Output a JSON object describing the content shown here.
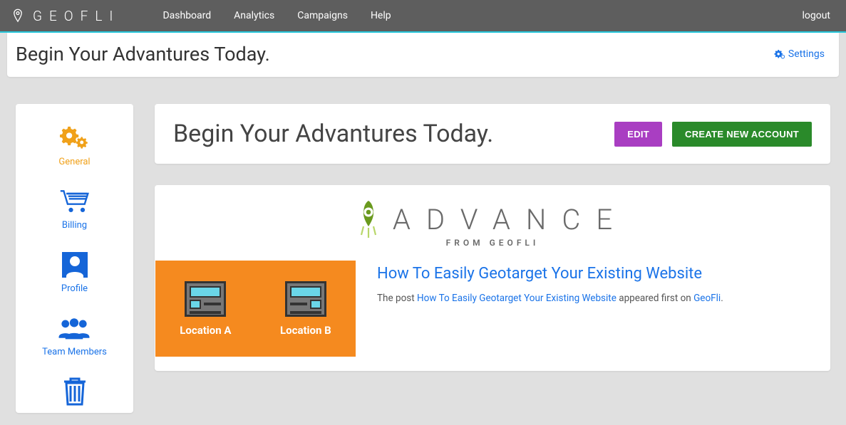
{
  "header": {
    "brand": "GEOFLI",
    "nav": {
      "dashboard": "Dashboard",
      "analytics": "Analytics",
      "campaigns": "Campaigns",
      "help": "Help"
    },
    "logout": "logout"
  },
  "titlebar": {
    "title": "Begin Your Advantures Today.",
    "settings_label": "Settings"
  },
  "sidebar": {
    "items": [
      {
        "label": "General",
        "active": true
      },
      {
        "label": "Billing",
        "active": false
      },
      {
        "label": "Profile",
        "active": false
      },
      {
        "label": "Team Members",
        "active": false
      }
    ]
  },
  "panel": {
    "title": "Begin Your Advantures Today.",
    "edit_label": "EDIT",
    "create_label": "CREATE NEW ACCOUNT"
  },
  "brand_block": {
    "title": "ADVANCE",
    "subtitle": "FROM GEOFLI"
  },
  "article": {
    "thumb": {
      "loc_a": "Location A",
      "loc_b": "Location B"
    },
    "title": "How To Easily Geotarget Your Existing Website",
    "body_prefix": "The post ",
    "body_link1": "How To Easily Geotarget Your Existing Website",
    "body_mid": " appeared first on ",
    "body_link2": "GeoFli",
    "body_suffix": "."
  }
}
